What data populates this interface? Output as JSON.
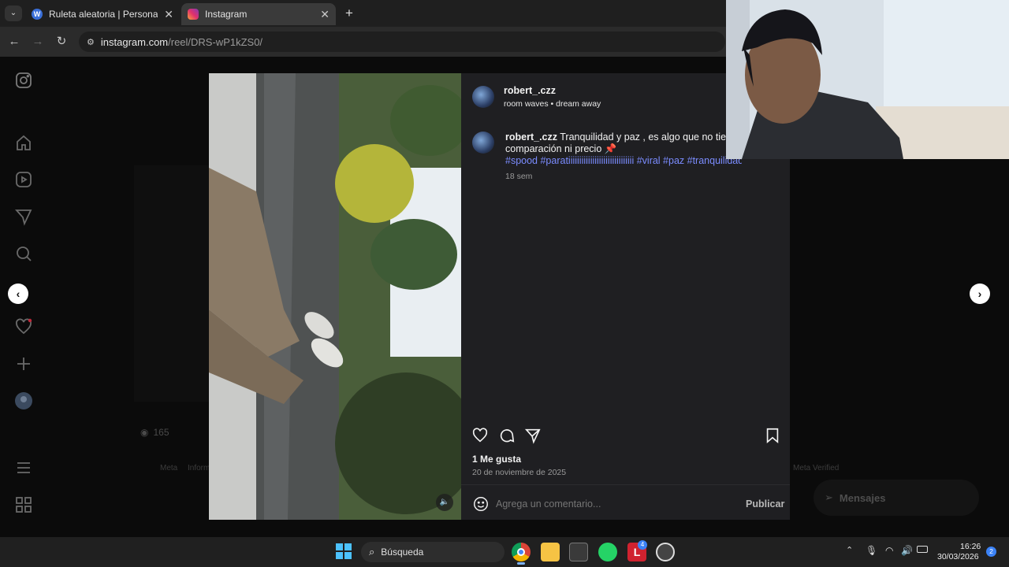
{
  "browser": {
    "tabs": [
      {
        "title": "Ruleta aleatoria | Personaliza y g",
        "favicon": "wheel-icon",
        "active": false
      },
      {
        "title": "Instagram",
        "favicon": "instagram-icon",
        "active": true
      }
    ],
    "url_host": "instagram.com",
    "url_path": "/reel/DRS-wP1kZS0/"
  },
  "sidebar": {
    "items": [
      "instagram-logo",
      "home-icon",
      "reels-icon",
      "messages-icon",
      "search-icon",
      "explore-icon",
      "notifications-icon",
      "create-icon",
      "profile-avatar",
      "menu-icon",
      "apps-icon"
    ]
  },
  "background": {
    "views": "165",
    "footer_left": "Meta",
    "footer_info": "Inform",
    "footer_right": "Meta Verified",
    "messages_label": "Mensajes"
  },
  "post": {
    "username": "robert_.czz",
    "audio": "room waves • dream away",
    "caption_user": "robert_.czz",
    "caption_text": " Tranquilidad y paz , es algo que no tiene comparación ni precio 📌",
    "hashtags": "#spood #paratiiiiiiiiiiiiiiiiiiiiiiiiiiiiii #viral #paz #tranquilidad",
    "age": "18 sem",
    "likes": "1 Me gusta",
    "date": "20 de noviembre de 2025",
    "comment_placeholder": "Agrega un comentario...",
    "publish_label": "Publicar"
  },
  "taskbar": {
    "search_label": "Búsqueda",
    "time": "16:26",
    "date": "30/03/2026",
    "notifications": "2",
    "badge_app": "4"
  },
  "colors": {
    "accent_link": "#7b8cff",
    "modal_bg": "#1f1f22",
    "taskbar_bg": "#202020"
  }
}
